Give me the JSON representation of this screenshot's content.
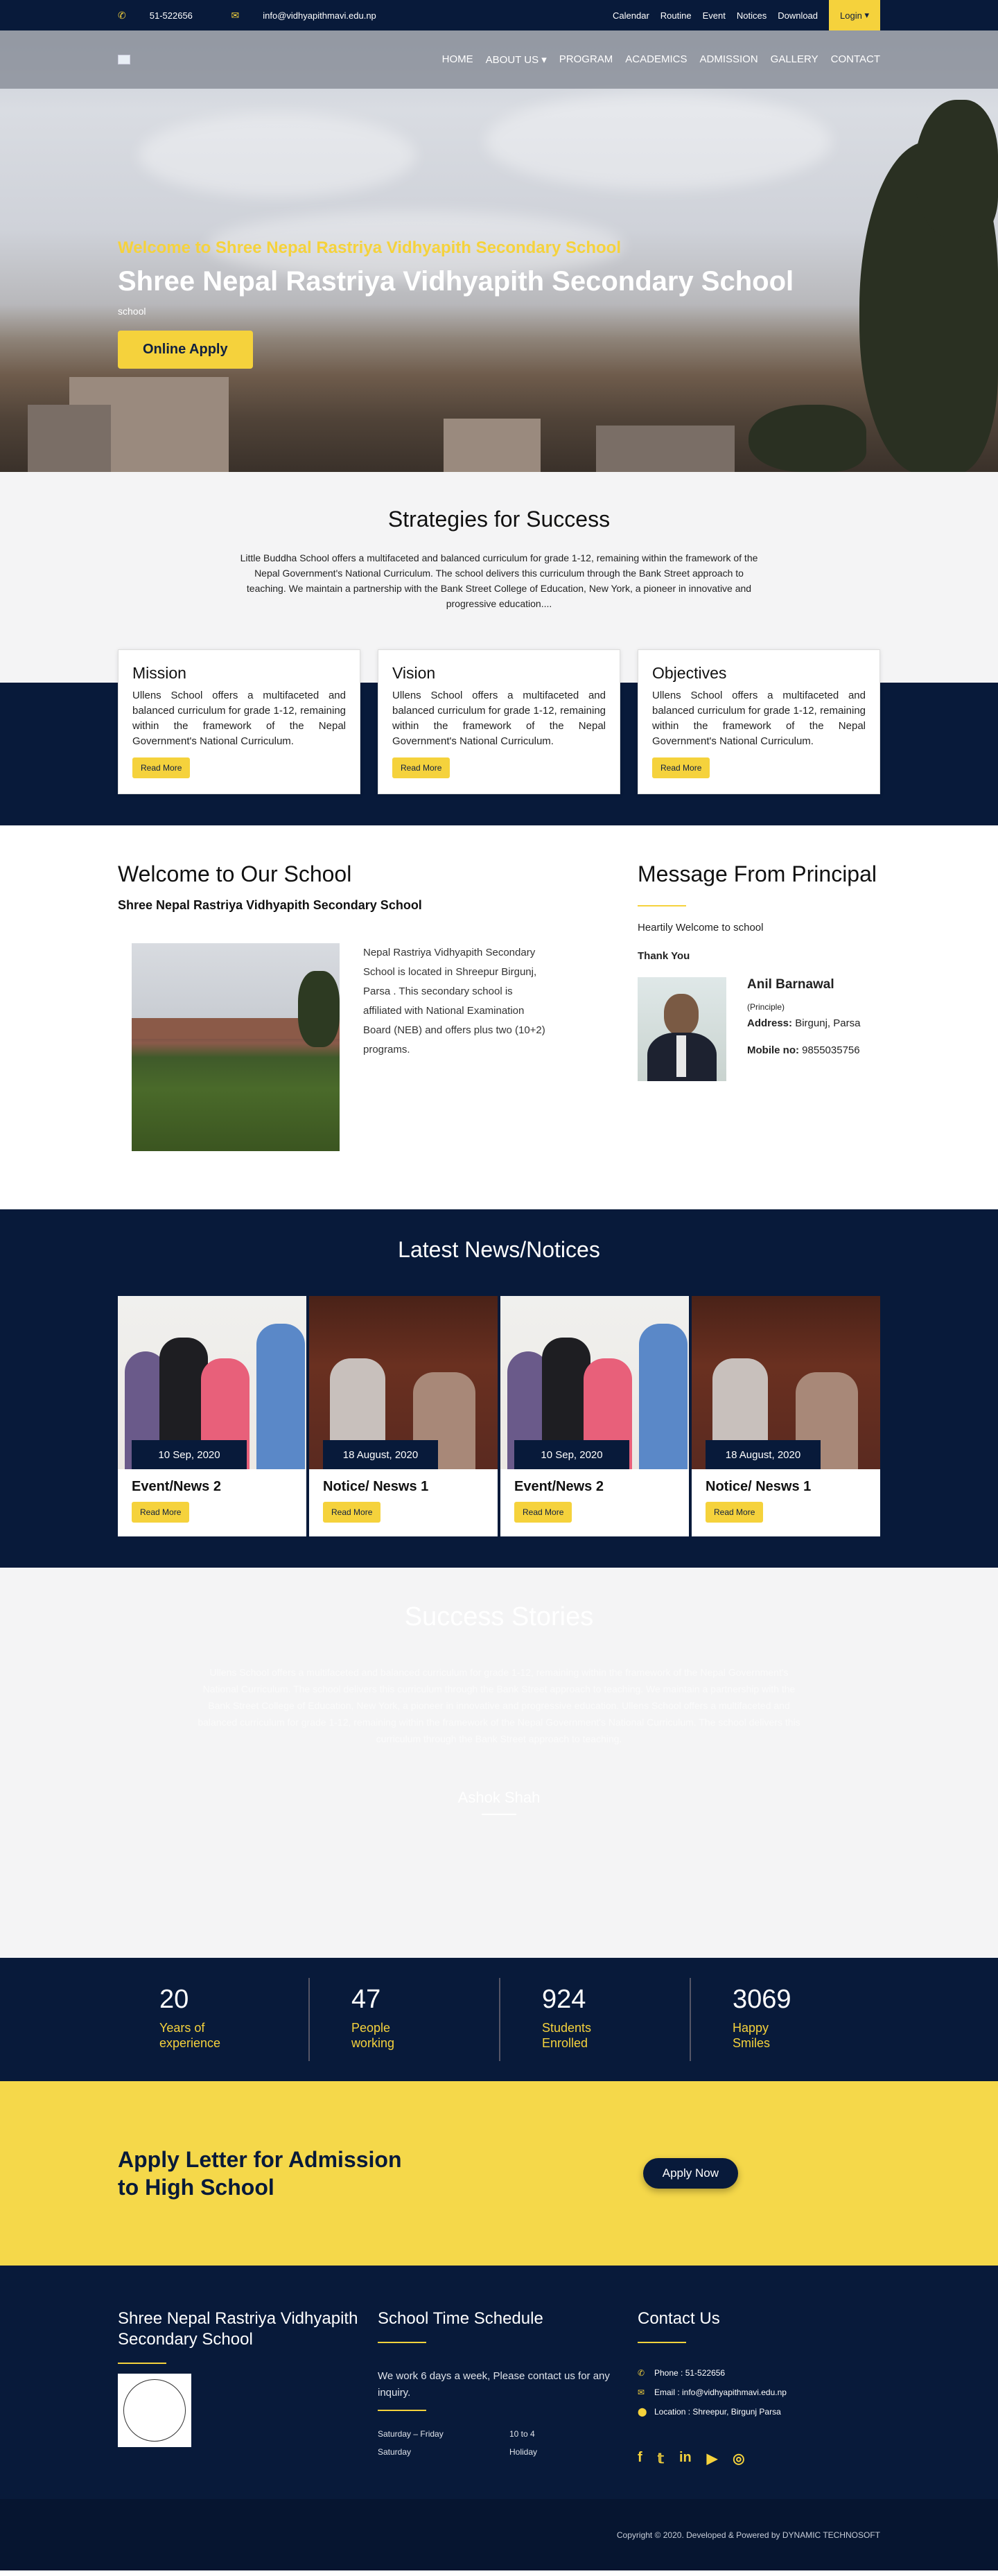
{
  "topbar": {
    "phone": "51-522656",
    "email": "info@vidhyapithmavi.edu.np",
    "links": [
      "Calendar",
      "Routine",
      "Event",
      "Notices",
      "Download"
    ],
    "login": "Login"
  },
  "nav": {
    "items": [
      "HOME",
      "ABOUT US",
      "PROGRAM",
      "ACADEMICS",
      "ADMISSION",
      "GALLERY",
      "CONTACT"
    ]
  },
  "hero": {
    "subtitle": "Welcome to Shree Nepal Rastriya Vidhyapith Secondary School",
    "title": "Shree Nepal Rastriya Vidhyapith Secondary School",
    "small": "school",
    "button": "Online Apply"
  },
  "strategies": {
    "title": "Strategies for Success",
    "text": "Little Buddha School offers a multifaceted and balanced curriculum for grade 1-12, remaining within the framework of the Nepal Government's National Curriculum. The school delivers this curriculum through the Bank Street approach to teaching. We maintain a partnership with the Bank Street College of Education, New York, a pioneer in innovative and progressive education....",
    "cards": [
      {
        "title": "Mission",
        "text": "Ullens School offers a multifaceted and balanced curriculum for grade 1-12, remaining within the framework of the Nepal Government's National Curriculum.",
        "button": "Read More"
      },
      {
        "title": "Vision",
        "text": "Ullens School offers a multifaceted and balanced curriculum for grade 1-12, remaining within the framework of the Nepal Government's National Curriculum.",
        "button": "Read More"
      },
      {
        "title": "Objectives",
        "text": "Ullens School offers a multifaceted and balanced curriculum for grade 1-12, remaining within the framework of the Nepal Government's National Curriculum.",
        "button": "Read More"
      }
    ]
  },
  "welcome": {
    "title": "Welcome to Our School",
    "subtitle": "Shree Nepal Rastriya Vidhyapith Secondary School",
    "text": "Nepal Rastriya Vidhyapith Secondary School is located in Shreepur Birgunj, Parsa . This secondary school is affiliated with National Examination Board (NEB) and offers plus two (10+2) programs."
  },
  "principal": {
    "title": "Message From Principal",
    "greeting": "Heartily Welcome to school",
    "thanks": "Thank You",
    "name": "Anil Barnawal",
    "role": "(Principle)",
    "address_label": "Address:",
    "address": "Birgunj, Parsa",
    "mobile_label": "Mobile no:",
    "mobile": "9855035756"
  },
  "news": {
    "title": "Latest News/Notices",
    "items": [
      {
        "date": "10 Sep, 2020",
        "title": "Event/News 2",
        "button": "Read More"
      },
      {
        "date": "18 August, 2020",
        "title": "Notice/ Nesws 1",
        "button": "Read More"
      },
      {
        "date": "10 Sep, 2020",
        "title": "Event/News 2",
        "button": "Read More"
      },
      {
        "date": "18 August, 2020",
        "title": "Notice/ Nesws 1",
        "button": "Read More"
      }
    ]
  },
  "success": {
    "title": "Success Stories",
    "text": "Ullens School offers a multifaceted and balanced curriculum for grade 1-12, remaining within the framework of the Nepal Government's National Curriculum. The school delivers this curriculum through the Bank Street approach to teaching. We maintain a partnership with the Bank Street College of Education, New York, a pioneer in innovative and progressive education. Ullens School offers a multifaceted and balanced curriculum for grade 1-12, remaining within the framework of the Nepal Government's National Curriculum. The school delivers this curriculum through the Bank Street approach to teaching.",
    "name": "Ashok Shah"
  },
  "counters": [
    {
      "num": "20",
      "label": "Years of experience"
    },
    {
      "num": "47",
      "label": "People working"
    },
    {
      "num": "924",
      "label": "Students Enrolled"
    },
    {
      "num": "3069",
      "label": "Happy Smiles"
    }
  ],
  "apply": {
    "title": "Apply Letter for Admission to High School",
    "button": "Apply Now"
  },
  "footer": {
    "school_name": "Shree Nepal Rastriya Vidhyapith Secondary School",
    "schedule_title": "School Time Schedule",
    "schedule_text": "We work 6 days a week, Please contact us for any inquiry.",
    "schedule": [
      {
        "day": "Saturday – Friday",
        "time": "10 to 4"
      },
      {
        "day": "Saturday",
        "time": "Holiday"
      }
    ],
    "contact_title": "Contact Us",
    "contact": [
      {
        "icon": "phone-icon",
        "text": "Phone : 51-522656"
      },
      {
        "icon": "mail-icon",
        "text": "Email : info@vidhyapithmavi.edu.np"
      },
      {
        "icon": "location-icon",
        "text": "Location : Shreepur, Birgunj Parsa"
      }
    ],
    "social": [
      "facebook-icon",
      "twitter-icon",
      "linkedin-icon",
      "youtube-icon",
      "instagram-icon"
    ]
  },
  "copyright": "Copyright © 2020. Developed & Powered by DYNAMIC TECHNOSOFT",
  "colors": {
    "navy": "#081a3a",
    "yellow": "#f5d23c"
  }
}
